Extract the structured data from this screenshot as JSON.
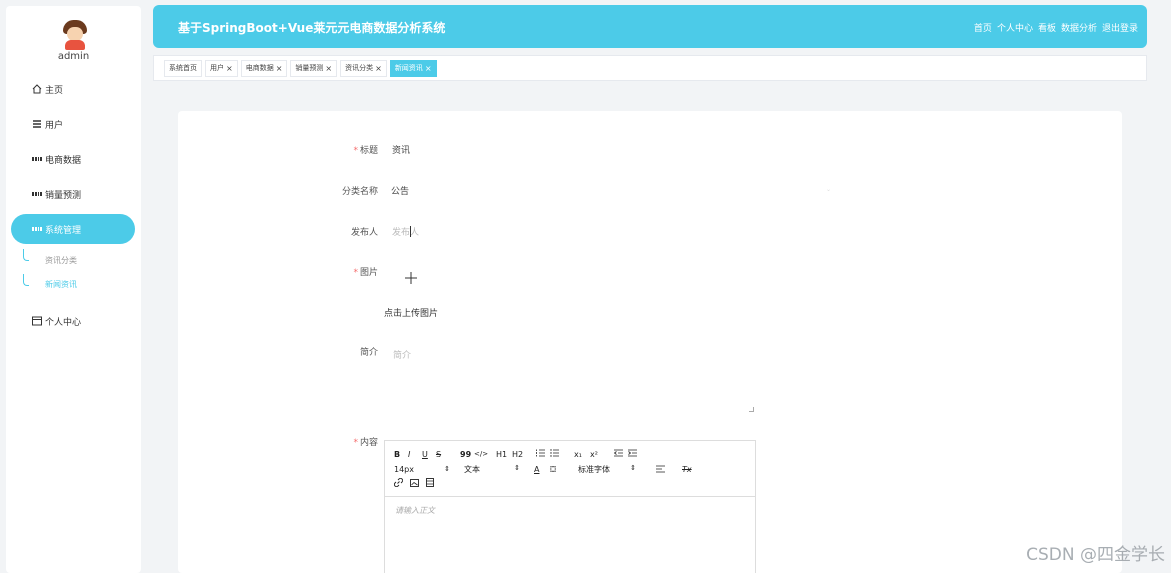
{
  "sidebar": {
    "username": "admin",
    "items": [
      {
        "label": "主页",
        "icon": "home-icon"
      },
      {
        "label": "用户",
        "icon": "list-icon"
      },
      {
        "label": "电商数据",
        "icon": "grid-icon"
      },
      {
        "label": "销量预测",
        "icon": "grid-icon"
      },
      {
        "label": "系统管理",
        "icon": "grid-icon",
        "active": true
      },
      {
        "label": "个人中心",
        "icon": "window-icon"
      }
    ],
    "subitems": [
      {
        "label": "资讯分类"
      },
      {
        "label": "新闻资讯",
        "current": true
      }
    ]
  },
  "header": {
    "title": "基于SpringBoot+Vue莱元元电商数据分析系统",
    "links": [
      "首页",
      "个人中心",
      "看板",
      "数据分析",
      "退出登录"
    ]
  },
  "tabs": [
    {
      "label": "系统首页",
      "closable": false
    },
    {
      "label": "用户",
      "closable": true
    },
    {
      "label": "电商数据",
      "closable": true
    },
    {
      "label": "销量预测",
      "closable": true
    },
    {
      "label": "资讯分类",
      "closable": true
    },
    {
      "label": "新闻资讯",
      "closable": true,
      "active": true
    }
  ],
  "form": {
    "title_label": "标题",
    "title_value": "资讯",
    "category_label": "分类名称",
    "category_value": "公告",
    "publisher_label": "发布人",
    "publisher_placeholder": "发布人",
    "image_label": "图片",
    "upload_text": "点击上传图片",
    "intro_label": "简介",
    "intro_placeholder": "简介",
    "content_label": "内容",
    "content_placeholder": "请输入正文"
  },
  "editor": {
    "row1": [
      "B",
      "I",
      "U",
      "S",
      "99",
      "</>",
      "H1",
      "H2",
      "ol",
      "ul",
      "x₁",
      "x²",
      "outdent",
      "indent"
    ],
    "font_size": "14px",
    "text_format": "文本",
    "font_family": "标准字体",
    "clear_format": "Tx"
  },
  "watermark": "CSDN @四金学长",
  "colors": {
    "accent": "#4ccbe8",
    "required": "#f56c6c"
  }
}
